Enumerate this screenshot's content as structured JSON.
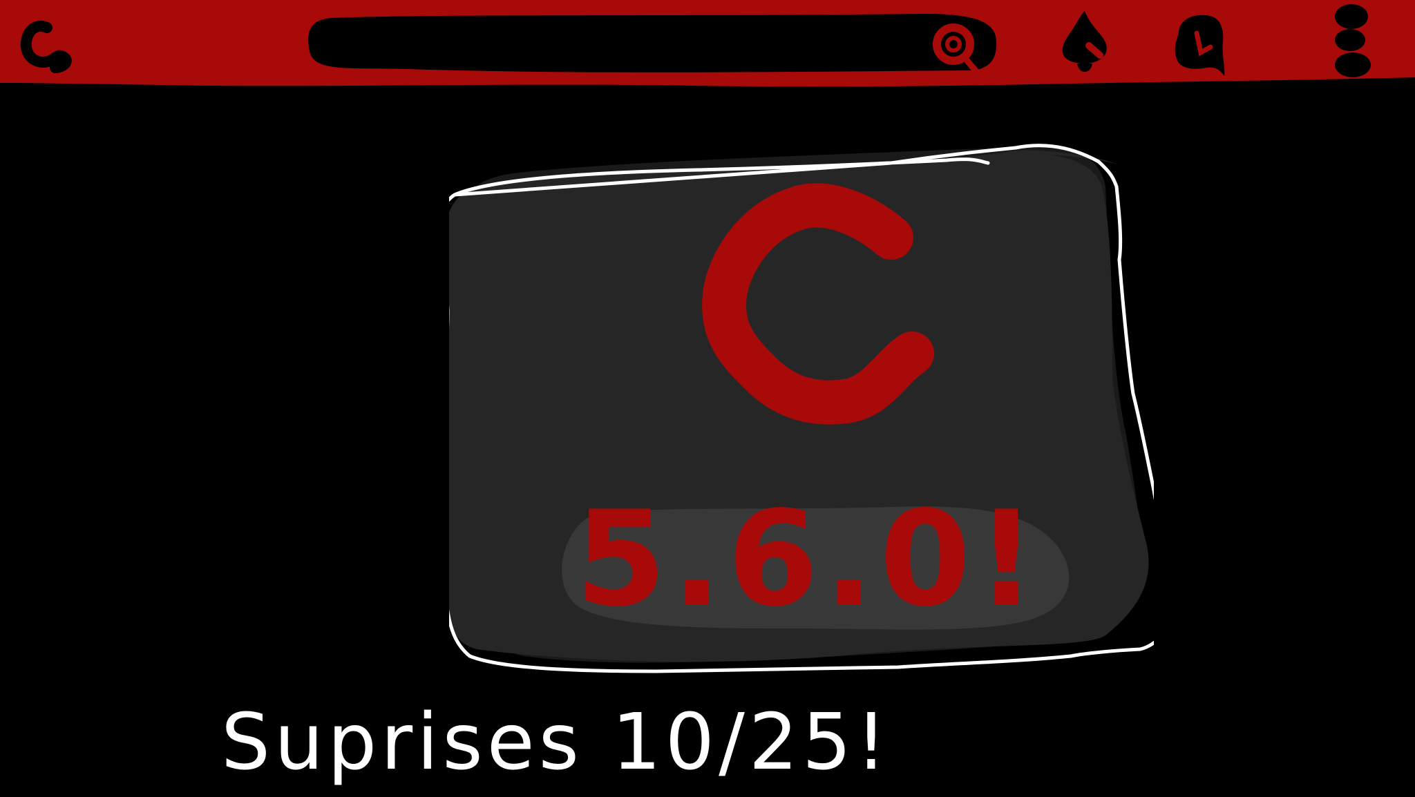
{
  "colors": {
    "background": "#000000",
    "topbar": "#a80a0a",
    "accent_red": "#a80a0a",
    "card_fill": "#262626",
    "card_outline": "#ffffff",
    "pill_fill": "#383838",
    "text_white": "#ffffff"
  },
  "topbar": {
    "logo_letter": "C",
    "search_icon": "search-icon",
    "icons": [
      "bell-icon",
      "chat-icon",
      "menu-icon"
    ]
  },
  "card": {
    "logo_letter": "C",
    "version": "5.6.0!"
  },
  "caption": {
    "text": "Suprises 10/25!"
  }
}
